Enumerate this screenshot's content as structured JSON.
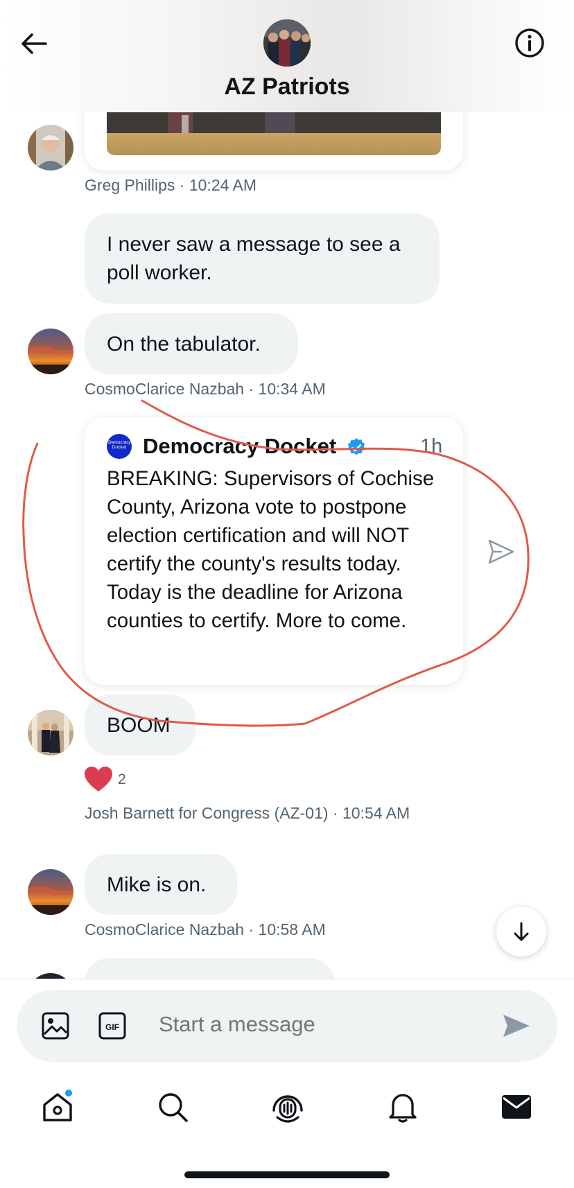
{
  "header": {
    "title": "AZ Patriots"
  },
  "messages": [
    {
      "sender": "Greg Phillips",
      "time": "10:24 AM"
    },
    {
      "text": "I never saw a message to see a poll worker."
    },
    {
      "text": "On the tabulator.",
      "sender": "CosmoClarice Nazbah",
      "time": "10:34 AM"
    },
    {
      "quoted_tweet": {
        "author": "Democracy Docket",
        "age": "1h",
        "avatar_text": "Democracy Docket",
        "verified": true,
        "body": "BREAKING: Supervisors of Cochise County, Arizona vote to postpone election certification and will NOT certify the county's results today. Today is the deadline for Arizona counties to certify. More to come."
      }
    },
    {
      "text": "BOOM",
      "reaction": {
        "icon": "heart-icon",
        "count": "2"
      },
      "sender": "Josh Barnett for Congress (AZ-01)",
      "time": "10:54 AM"
    },
    {
      "text": "Mike is on.",
      "sender": "CosmoClarice Nazbah",
      "time": "10:58 AM"
    }
  ],
  "composer": {
    "placeholder": "Start a message"
  },
  "tabbar": {
    "items": [
      "home-icon",
      "search-icon",
      "spaces-icon",
      "notifications-icon",
      "messages-icon"
    ]
  },
  "colors": {
    "accent": "#1d9bf0",
    "bubble": "#eff3f4",
    "meta_text": "#536471",
    "annotation": "#e05a4a",
    "heart": "#d93d4f"
  }
}
